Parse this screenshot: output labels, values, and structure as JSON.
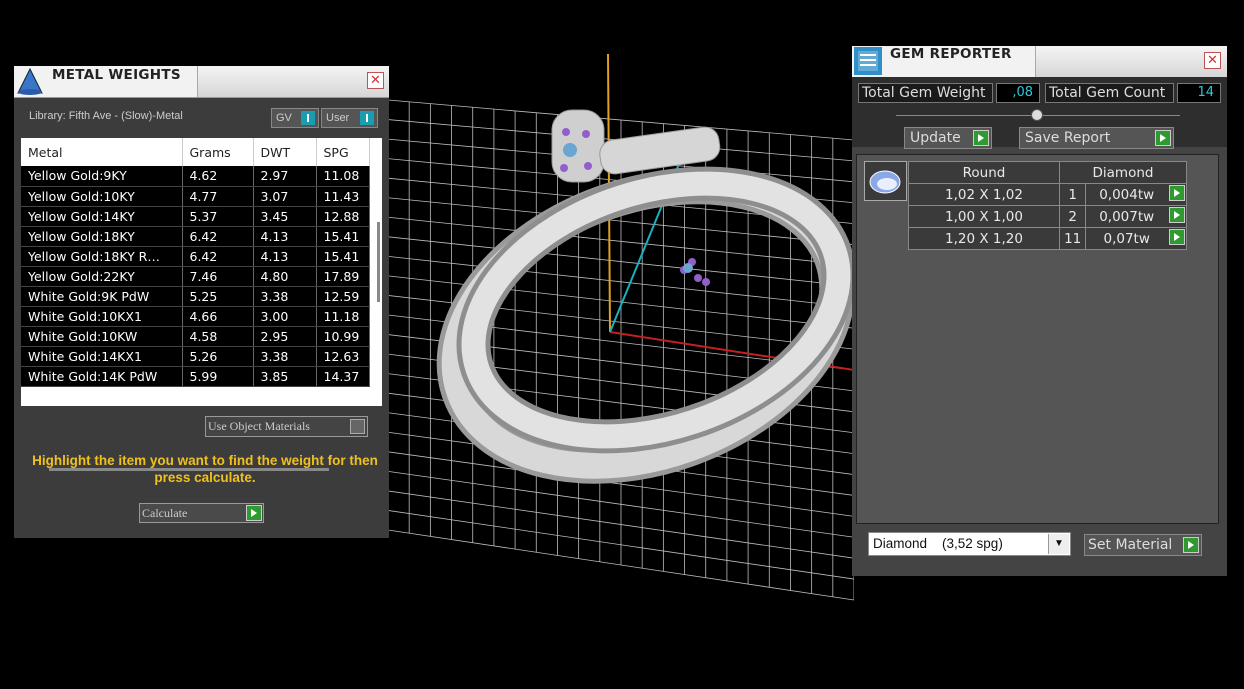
{
  "metal_panel": {
    "title": "METAL WEIGHTS",
    "close": "✕",
    "library_label": "Library: Fifth Ave - (Slow)-Metal",
    "toggle_gv": "GV",
    "toggle_user": "User",
    "columns": [
      "Metal",
      "Grams",
      "DWT",
      "SPG"
    ],
    "rows": [
      [
        "Yellow Gold:9KY",
        "4.62",
        "2.97",
        "11.08"
      ],
      [
        "Yellow Gold:10KY",
        "4.77",
        "3.07",
        "11.43"
      ],
      [
        "Yellow Gold:14KY",
        "5.37",
        "3.45",
        "12.88"
      ],
      [
        "Yellow Gold:18KY",
        "6.42",
        "4.13",
        "15.41"
      ],
      [
        "Yellow Gold:18KY R…",
        "6.42",
        "4.13",
        "15.41"
      ],
      [
        "Yellow Gold:22KY",
        "7.46",
        "4.80",
        "17.89"
      ],
      [
        "White Gold:9K PdW",
        "5.25",
        "3.38",
        "12.59"
      ],
      [
        "White Gold:10KX1",
        "4.66",
        "3.00",
        "11.18"
      ],
      [
        "White Gold:10KW",
        "4.58",
        "2.95",
        "10.99"
      ],
      [
        "White Gold:14KX1",
        "5.26",
        "3.38",
        "12.63"
      ],
      [
        "White Gold:14K PdW",
        "5.99",
        "3.85",
        "14.37"
      ]
    ],
    "use_object_materials": "Use Object Materials",
    "hint": "Highlight the item you want to find the weight for then press calculate.",
    "calculate": "Calculate"
  },
  "gem_panel": {
    "title": "GEM REPORTER",
    "close": "✕",
    "total_weight_label": "Total Gem Weight",
    "total_weight_value": ",08",
    "total_count_label": "Total Gem Count",
    "total_count_value": "14",
    "update": "Update",
    "save_report": "Save Report",
    "cut": "Round",
    "material": "Diamond",
    "gems": [
      [
        "1,02 X 1,02",
        "1",
        "0,004tw"
      ],
      [
        "1,00 X 1,00",
        "2",
        "0,007tw"
      ],
      [
        "1,20 X 1,20",
        "11",
        "0,07tw"
      ]
    ],
    "material_select": "Diamond    (3,52 spg)",
    "set_material": "Set Material"
  },
  "colors": {
    "accent": "#1a9db0",
    "hint": "#f0c020",
    "go": "#2f9a2f",
    "axis_x": "#c42020",
    "axis_y": "#1ab0c0",
    "axis_z": "#e0a020"
  }
}
